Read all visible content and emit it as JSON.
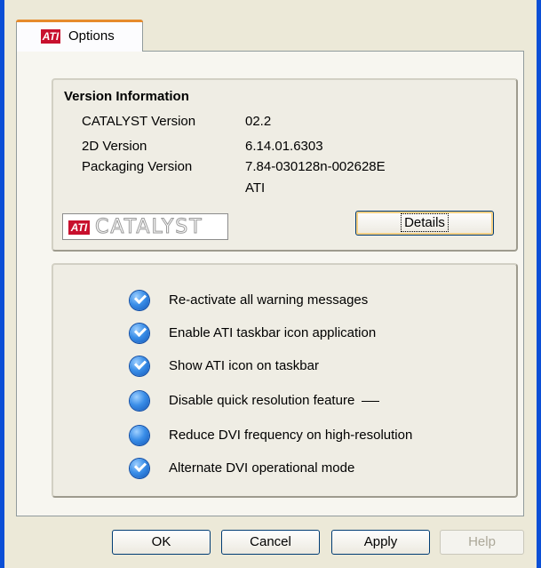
{
  "tab": {
    "label": "Options",
    "logo_text": "ATI"
  },
  "version_info": {
    "title": "Version Information",
    "rows": [
      {
        "label": "CATALYST Version",
        "value": "02.2"
      },
      {
        "label": "2D Version",
        "value": "6.14.01.6303"
      },
      {
        "label": "Packaging Version",
        "value": "7.84-030128n-002628E"
      },
      {
        "label": "",
        "value": "ATI"
      }
    ],
    "logo_mark": "ATI",
    "logo_word": "CATALYST",
    "details_button": "Details"
  },
  "options": [
    {
      "label": "Re-activate all warning messages",
      "checked": true
    },
    {
      "label": "Enable ATI taskbar icon application",
      "checked": true
    },
    {
      "label": "Show ATI icon on taskbar",
      "checked": true
    },
    {
      "label": "Disable quick resolution feature",
      "checked": false
    },
    {
      "label": "Reduce DVI frequency on high-resolution",
      "checked": false
    },
    {
      "label": "Alternate DVI operational mode",
      "checked": true
    }
  ],
  "footer": {
    "ok": "OK",
    "cancel": "Cancel",
    "apply": "Apply",
    "help": "Help"
  },
  "colors": {
    "title_border": "#0b4fd6",
    "tab_accent": "#e68b2c",
    "ati_red": "#c8102e"
  }
}
